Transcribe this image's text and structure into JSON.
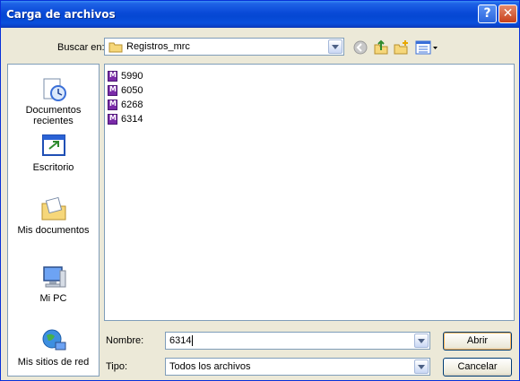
{
  "dialog": {
    "title": "Carga de archivos",
    "help_glyph": "?",
    "close_glyph": "✕"
  },
  "lookin": {
    "label": "Buscar en:",
    "value": "Registros_mrc",
    "icon": "folder-icon"
  },
  "toolbar": {
    "items": [
      "back-icon",
      "up-folder-icon",
      "new-folder-icon",
      "view-menu-icon"
    ]
  },
  "places": [
    {
      "label": "Documentos recientes",
      "icon": "recent-documents-icon"
    },
    {
      "label": "Escritorio",
      "icon": "desktop-icon"
    },
    {
      "label": "Mis documentos",
      "icon": "my-documents-icon"
    },
    {
      "label": "Mi PC",
      "icon": "my-computer-icon"
    },
    {
      "label": "Mis sitios de red",
      "icon": "network-places-icon"
    }
  ],
  "files": [
    {
      "name": "5990"
    },
    {
      "name": "6050"
    },
    {
      "name": "6268"
    },
    {
      "name": "6314"
    }
  ],
  "filename": {
    "label": "Nombre:",
    "value": "6314"
  },
  "filetype": {
    "label": "Tipo:",
    "value": "Todos los archivos"
  },
  "buttons": {
    "open": "Abrir",
    "cancel": "Cancelar"
  },
  "colors": {
    "titlebar": "#0a4ad8",
    "dialog_bg": "#ece9d8",
    "field_border": "#7f9db9",
    "file_icon": "#7a2ba8"
  }
}
